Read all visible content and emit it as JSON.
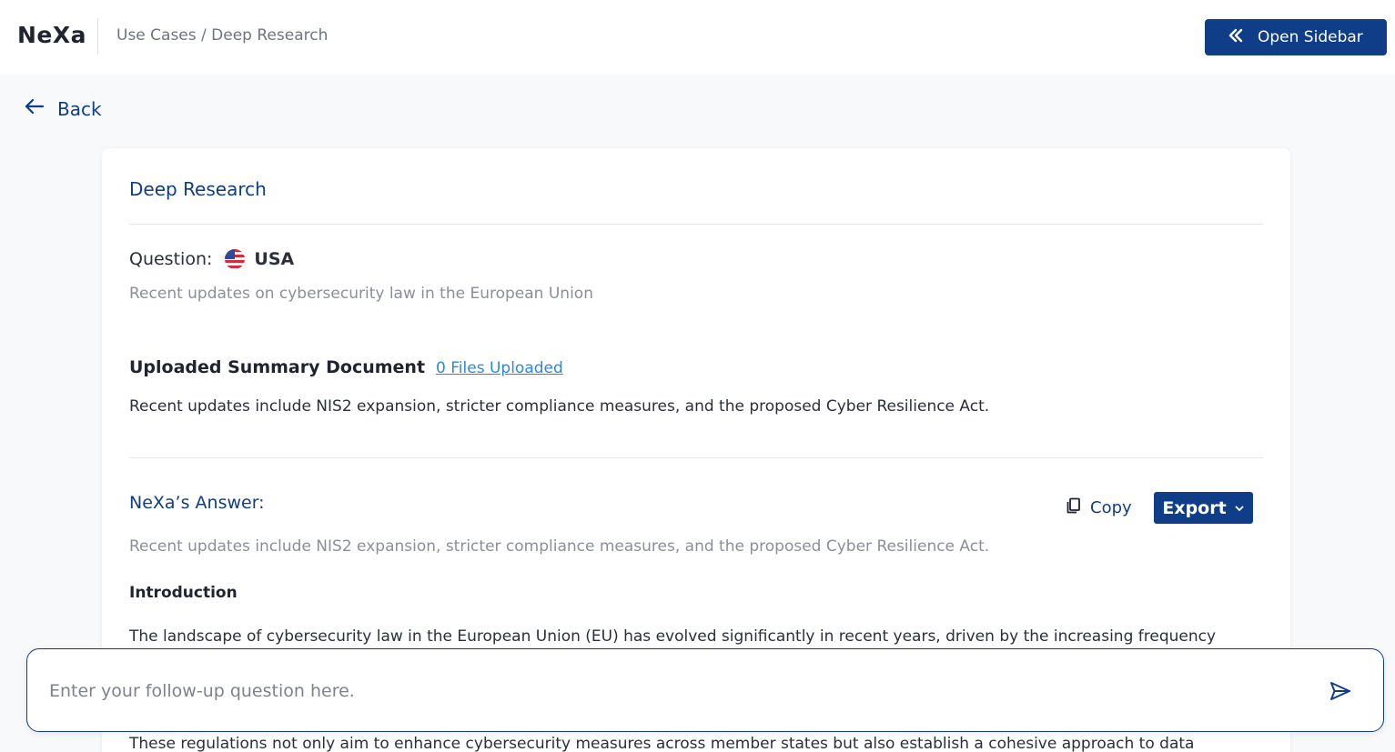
{
  "header": {
    "logo": "NeXa",
    "breadcrumb": [
      "Use Cases",
      "/",
      "Deep Research"
    ],
    "open_sidebar_label": "Open Sidebar"
  },
  "nav": {
    "back_label": "Back"
  },
  "card": {
    "title": "Deep Research",
    "question_label": "Question:",
    "question_country": "USA",
    "question_text": "Recent updates on cybersecurity law in the European Union",
    "uploaded_title": "Uploaded Summary Document",
    "uploaded_link": "0 Files Uploaded",
    "uploaded_text": "Recent updates include NIS2 expansion, stricter compliance measures, and the proposed Cyber Resilience Act.",
    "answer_title": "NeXa’s Answer:",
    "copy_label": "Copy",
    "export_label": "Export",
    "answer_summary": "Recent updates include NIS2 expansion, stricter compliance measures, and the proposed Cyber Resilience Act.",
    "intro_heading": "Introduction",
    "paragraph_1": "The landscape of cybersecurity law in the European Union (EU) has evolved significantly in recent years, driven by the increasing frequency",
    "paragraph_2": "These regulations not only aim to enhance cybersecurity measures across member states but also establish a cohesive approach to data"
  },
  "followup": {
    "placeholder": "Enter your follow-up question here."
  },
  "icons": [
    "chevrons-left-icon",
    "arrow-left-icon",
    "us-flag-icon",
    "copy-icon",
    "chevron-down-icon",
    "send-icon"
  ],
  "colors": {
    "primary": "#0f3d87",
    "link": "#2b87e3",
    "muted": "#8a8f99"
  }
}
